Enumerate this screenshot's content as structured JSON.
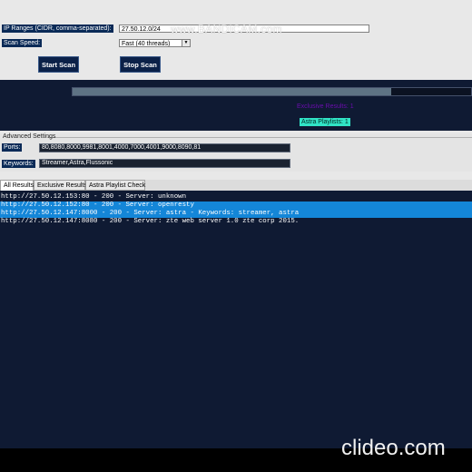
{
  "form": {
    "ip_label": "IP Ranges (CIDR, comma-separated):",
    "ip_value": "27.50.12.0/24",
    "speed_label": "Scan Speed:",
    "speed_value": "Fast (40 threads)",
    "start_label": "Start Scan",
    "stop_label": "Stop Scan"
  },
  "status": {
    "progress_fraction": 0.8,
    "exclusive_results": "Exclusive Results: 1",
    "astra_playlists": "Astra Playlists: 1"
  },
  "advanced": {
    "title": "Advanced Settings",
    "ports_label": "Ports:",
    "ports_value": "80,8080,8000,9981,8001,4000,7000,4001,9000,8090,81",
    "keywords_label": "Keywords:",
    "keywords_value": "Streamer,Astra,Flussonic"
  },
  "tabs": [
    {
      "label": "All Results"
    },
    {
      "label": "Exclusive Results"
    },
    {
      "label": "Astra Playlist Check"
    }
  ],
  "results": [
    "http://27.50.12.153:80 - 200 - Server: unknown",
    "http://27.50.12.152:80 - 200 - Server: openresty",
    "http://27.50.12.147:8000 - 200 - Server: astra - Keywords: streamer, astra",
    "http://27.50.12.147:8080 - 200 - Server: zte web server 1.0 zte corp 2015."
  ],
  "watermarks": {
    "top": "www.BANDICAM.com",
    "bottom": "clideo.com"
  },
  "colors": {
    "dark_bg": "#0f1a33",
    "label_bg": "#0a2a57",
    "selection": "#1486d8",
    "badge": "#31e4c6",
    "exclusive_text": "#6a0dad"
  }
}
